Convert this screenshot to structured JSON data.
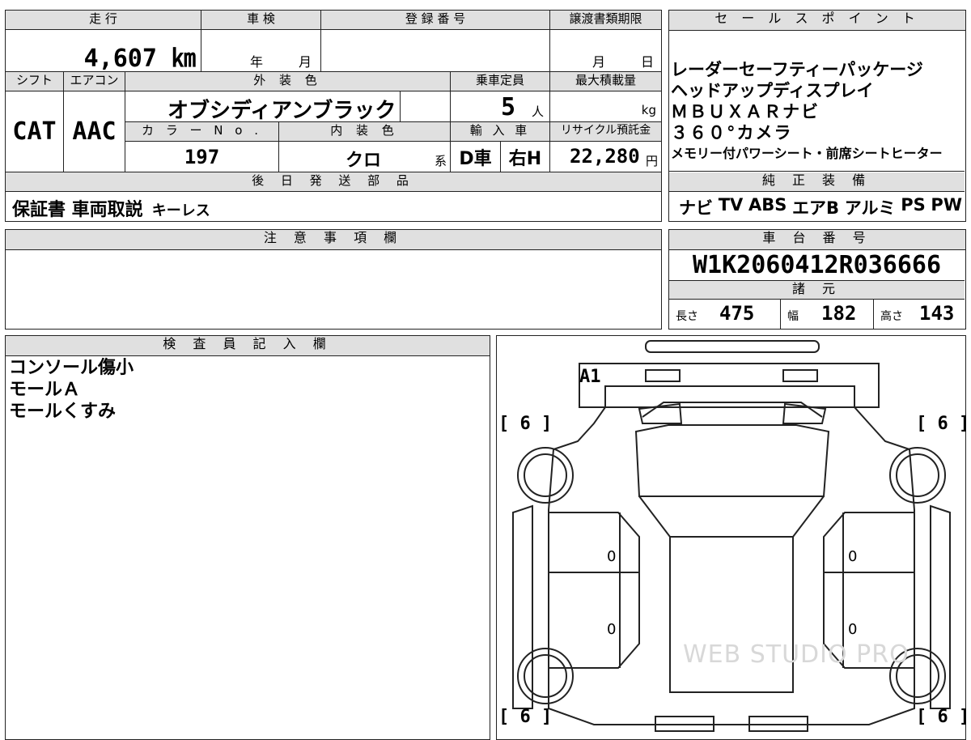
{
  "header": {
    "mileage_label": "走 行",
    "inspection_label": "車 検",
    "registration_label": "登 録 番 号",
    "transfer_deadline_label": "譲渡書類期限",
    "sales_point_label": "セ ー ル ス ポ イ ン ト"
  },
  "vehicle": {
    "mileage": "4,607 ㎞",
    "inspection_year": "年",
    "inspection_month": "月",
    "deadline_month": "月",
    "deadline_day": "日"
  },
  "specs": {
    "shift_label": "シフト",
    "aircon_label": "エアコン",
    "exterior_color_label": "外 装 色",
    "capacity_label": "乗車定員",
    "max_load_label": "最大積載量",
    "shift": "CAT",
    "aircon": "AAC",
    "exterior_color": "オブシディアンブラック",
    "capacity": "5",
    "capacity_unit": "人",
    "max_load_unit": "kg",
    "color_no_label": "カ ラ ー N o .",
    "interior_color_label": "内 装 色",
    "import_label": "輸 入 車",
    "recycle_label": "リサイクル預託金",
    "color_no": "197",
    "interior_color": "クロ",
    "interior_suffix": "系",
    "import_type": "D車",
    "steering": "右H",
    "recycle_fee": "22,280",
    "recycle_unit": "円"
  },
  "sales_points": [
    "レーダーセーフティーパッケージ",
    "ヘッドアップディスプレイ",
    "ＭＢＵＸＡＲナビ",
    "３６０°カメラ",
    "メモリー付パワーシート・前席シートヒーター"
  ],
  "after_parts": {
    "label": "後 日 発 送 部 品",
    "value_bold": "保証書 車両取説",
    "value_extra": "キーレス"
  },
  "equipment": {
    "label": "純 正 装 備",
    "items": [
      "ナビ",
      "TV",
      "ABS",
      "エアB",
      "アルミ",
      "PS",
      "PW"
    ]
  },
  "notes": {
    "label": "注 意 事 項 欄"
  },
  "chassis": {
    "label": "車 台 番 号",
    "number": "W1K2060412R036666",
    "dims_label": "諸 元",
    "length_label": "長さ",
    "length": "475",
    "width_label": "幅",
    "width": "182",
    "height_label": "高さ",
    "height": "143"
  },
  "inspector": {
    "label": "検 査 員 記 入 欄",
    "lines": [
      "コンソール傷小",
      "モールＡ",
      "モールくすみ"
    ]
  },
  "diagram": {
    "mark_a1": "A1",
    "tire_left_top": "[ 6 ]",
    "tire_right_top": "[ 6 ]",
    "tire_left_bottom": "[ 6 ]",
    "tire_right_bottom": "[ 6 ]",
    "door_mark_1": "0",
    "door_mark_2": "0",
    "door_mark_3": "0",
    "door_mark_4": "0",
    "watermark": "WEB STUDIO PRO"
  }
}
